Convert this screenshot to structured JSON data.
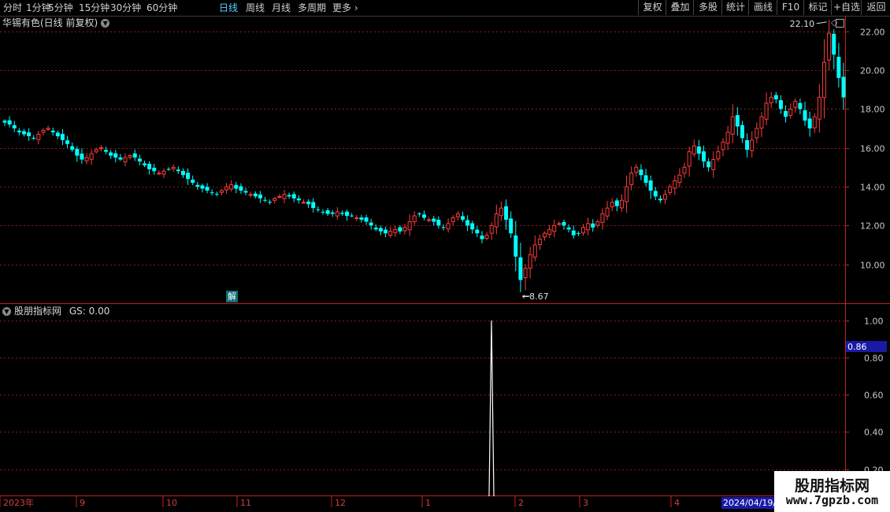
{
  "toolbar": {
    "periods": [
      "分时",
      "1分钟",
      "5分钟",
      "15分钟",
      "30分钟",
      "60分钟",
      "日线",
      "周线",
      "月线",
      "多周期",
      "更多"
    ],
    "active_period": "日线",
    "right_buttons": [
      "复权",
      "叠加",
      "多股",
      "统计",
      "画线",
      "F10",
      "标记",
      "+自选",
      "返回"
    ]
  },
  "main_panel": {
    "title": "华锡有色(日线 前复权)",
    "jie_label": "解"
  },
  "indicator_panel": {
    "title": "股朋指标网",
    "gs_label": "GS: 0.00"
  },
  "watermark": {
    "line1": "股朋指标网",
    "line2": "www.7gpzb.com"
  },
  "colors": {
    "up": "#ff3b3b",
    "down": "#00ffff",
    "grid": "#8b1a1a",
    "axis": "#c81e1e",
    "highlight_bg": "#1a1aa6"
  },
  "chart_data": [
    {
      "type": "candlestick",
      "title": "华锡有色(日线 前复权)",
      "ylim": [
        8.0,
        22.8
      ],
      "yticks": [
        "22.00",
        "20.00",
        "18.00",
        "16.00",
        "14.00",
        "12.00",
        "10.00"
      ],
      "annotations": [
        {
          "label": "22.10",
          "kind": "high"
        },
        {
          "label": "8.67",
          "kind": "low"
        }
      ],
      "x_labels": [
        "2023年",
        "9",
        "10",
        "11",
        "12",
        "1",
        "2",
        "3",
        "4",
        "2024/04/19/"
      ],
      "highlight_date": "2024/04/19/",
      "close_series": [
        17.3,
        17.2,
        17.0,
        16.8,
        16.7,
        16.6,
        16.5,
        16.7,
        16.9,
        17.0,
        16.8,
        16.6,
        16.4,
        16.2,
        15.9,
        15.6,
        15.4,
        15.5,
        15.7,
        15.9,
        16.0,
        15.8,
        15.6,
        15.5,
        15.4,
        15.5,
        15.6,
        15.5,
        15.3,
        15.1,
        14.9,
        14.8,
        14.7,
        14.8,
        14.9,
        15.0,
        14.8,
        14.6,
        14.4,
        14.2,
        14.0,
        13.9,
        13.8,
        13.7,
        13.6,
        13.8,
        14.0,
        14.1,
        13.9,
        13.8,
        13.7,
        13.6,
        13.5,
        13.4,
        13.3,
        13.2,
        13.4,
        13.5,
        13.6,
        13.5,
        13.4,
        13.3,
        13.2,
        13.1,
        12.9,
        12.8,
        12.7,
        12.6,
        12.6,
        12.7,
        12.6,
        12.5,
        12.5,
        12.4,
        12.3,
        12.2,
        12.0,
        11.8,
        11.7,
        11.6,
        11.7,
        11.8,
        11.7,
        11.9,
        12.2,
        12.5,
        12.6,
        12.4,
        12.3,
        12.2,
        12.0,
        11.9,
        12.1,
        12.4,
        12.6,
        12.3,
        12.0,
        11.8,
        11.6,
        11.3,
        11.5,
        12.0,
        12.6,
        12.9,
        12.3,
        11.6,
        10.4,
        9.2,
        9.8,
        10.5,
        11.0,
        11.3,
        11.6,
        11.8,
        12.0,
        12.1,
        12.0,
        11.8,
        11.5,
        11.6,
        11.9,
        12.1,
        11.9,
        12.2,
        12.6,
        12.9,
        13.2,
        13.0,
        13.3,
        14.0,
        14.7,
        15.0,
        14.6,
        14.2,
        13.8,
        13.5,
        13.3,
        13.6,
        14.0,
        14.3,
        14.6,
        15.0,
        15.8,
        16.1,
        15.7,
        15.3,
        15.0,
        15.4,
        15.8,
        16.3,
        16.8,
        17.6,
        17.1,
        16.5,
        15.9,
        16.4,
        17.0,
        17.6,
        18.3,
        18.6,
        18.5,
        18.0,
        17.6,
        18.0,
        18.4,
        18.0,
        17.4,
        17.0,
        17.6,
        18.6,
        20.4,
        21.9,
        20.8,
        19.6,
        18.6
      ]
    },
    {
      "type": "line",
      "title": "股朋指标网",
      "ylim": [
        0.05,
        1.08
      ],
      "yticks": [
        "1.00",
        "0.80",
        "0.60",
        "0.40",
        "0.20"
      ],
      "current_value_label": "0.86",
      "spike_value": 1.0,
      "baseline_value": 0.0
    }
  ]
}
